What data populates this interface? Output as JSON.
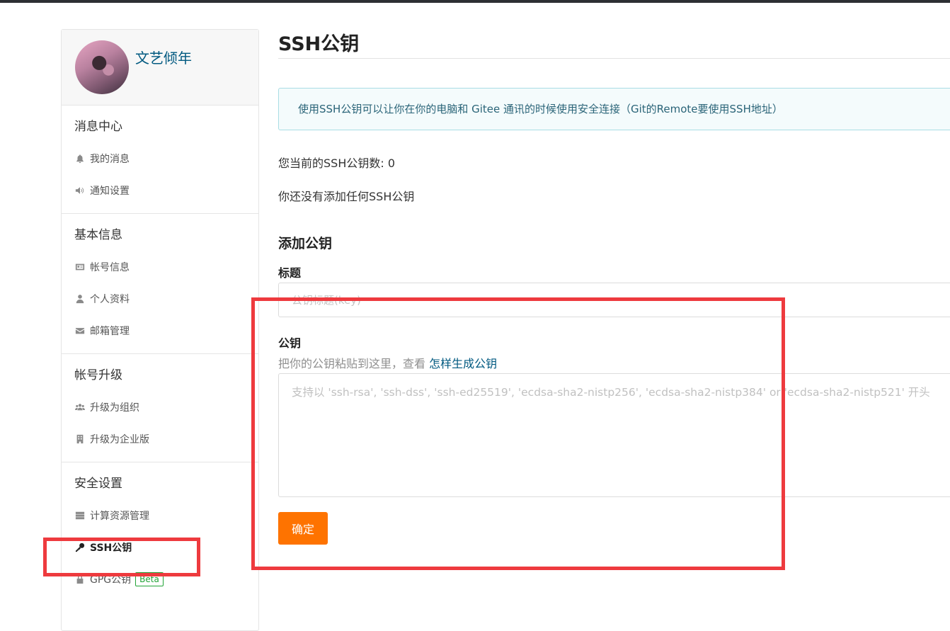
{
  "user": {
    "name": "文艺倾年"
  },
  "sidebar": {
    "sections": [
      {
        "title": "消息中心",
        "items": [
          {
            "label": "我的消息",
            "icon": "bell-icon"
          },
          {
            "label": "通知设置",
            "icon": "volume-icon"
          }
        ]
      },
      {
        "title": "基本信息",
        "items": [
          {
            "label": "帐号信息",
            "icon": "id-card-icon"
          },
          {
            "label": "个人资料",
            "icon": "user-icon"
          },
          {
            "label": "邮箱管理",
            "icon": "envelope-icon"
          }
        ]
      },
      {
        "title": "帐号升级",
        "items": [
          {
            "label": "升级为组织",
            "icon": "users-icon"
          },
          {
            "label": "升级为企业版",
            "icon": "building-icon"
          }
        ]
      },
      {
        "title": "安全设置",
        "items": [
          {
            "label": "计算资源管理",
            "icon": "server-icon"
          },
          {
            "label": "SSH公钥",
            "icon": "key-icon",
            "active": true
          },
          {
            "label": "GPG公钥",
            "icon": "lock-icon",
            "badge": "Beta"
          }
        ]
      }
    ]
  },
  "main": {
    "title": "SSH公钥",
    "info": "使用SSH公钥可以让你在你的电脑和 Gitee 通讯的时候使用安全连接（Git的Remote要使用SSH地址）",
    "key_count": "您当前的SSH公钥数: 0",
    "no_keys": "你还没有添加任何SSH公钥",
    "add_title": "添加公钥",
    "title_label": "标题",
    "title_placeholder": "公钥标题(key)",
    "key_label": "公钥",
    "key_hint": "把你的公钥粘贴到这里，查看 ",
    "key_hint_link": "怎样生成公钥",
    "key_placeholder": "支持以 'ssh-rsa', 'ssh-dss', 'ssh-ed25519', 'ecdsa-sha2-nistp256', 'ecdsa-sha2-nistp384' or 'ecdsa-sha2-nistp521' 开头",
    "submit_label": "确定"
  },
  "colors": {
    "accent": "#fe7300",
    "link": "#005980",
    "highlight": "#ee3a3e",
    "badge": "#21a336"
  }
}
